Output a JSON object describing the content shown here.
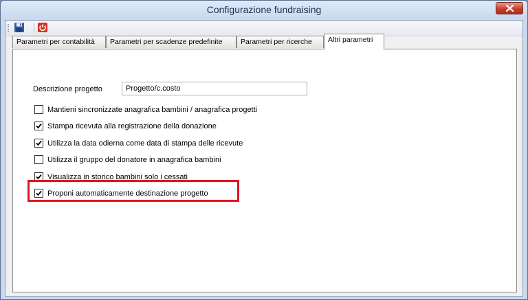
{
  "window": {
    "title": "Configurazione fundraising"
  },
  "tabs": [
    {
      "label": "Parametri per contabilità",
      "active": false
    },
    {
      "label": "Parametri per scadenze predefinite",
      "active": false
    },
    {
      "label": "Parametri per ricerche",
      "active": false
    },
    {
      "label": "Altri parametri",
      "active": true
    }
  ],
  "form": {
    "description_label": "Descrizione progetto",
    "description_value": "Progetto/c.costo",
    "options": [
      {
        "label": "Mantieni sincronizzate anagrafica bambini / anagrafica progetti",
        "checked": false
      },
      {
        "label": "Stampa ricevuta alla registrazione della donazione",
        "checked": true
      },
      {
        "label": "Utilizza la data odierna come data di stampa delle ricevute",
        "checked": true
      },
      {
        "label": "Utilizza il gruppo del donatore in anagrafica bambini",
        "checked": false
      },
      {
        "label": "Visualizza in storico bambini solo i cessati",
        "checked": true
      },
      {
        "label": "Proponi automaticamente destinazione progetto",
        "checked": true,
        "highlighted": true
      }
    ]
  },
  "colors": {
    "highlight": "#e0141e",
    "window_frame": "#c9d9ee"
  },
  "icons": {
    "save": "floppy-disk-icon",
    "exit": "power-icon",
    "close": "close-icon"
  }
}
